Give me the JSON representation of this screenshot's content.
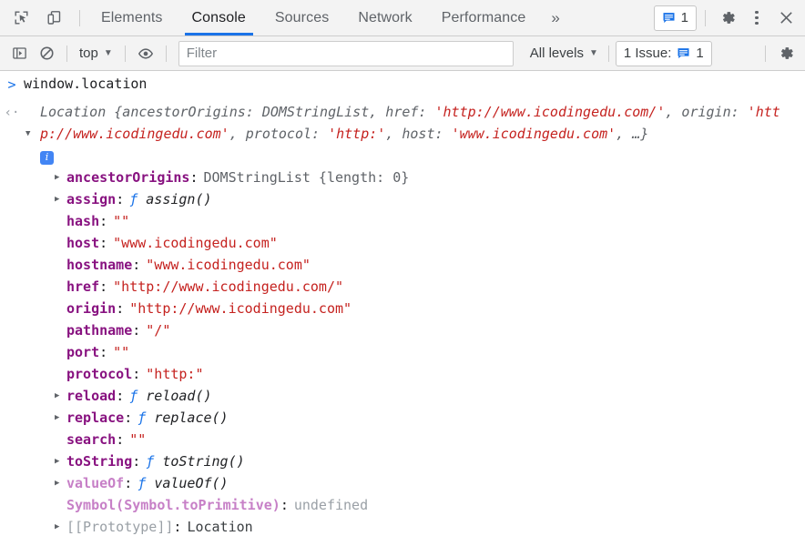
{
  "tabbar": {
    "inspect_icon": "inspect-cursor-icon",
    "device_icon": "device-toolbar-icon",
    "tabs": [
      {
        "label": "Elements",
        "active": false
      },
      {
        "label": "Console",
        "active": true
      },
      {
        "label": "Sources",
        "active": false
      },
      {
        "label": "Network",
        "active": false
      },
      {
        "label": "Performance",
        "active": false
      }
    ],
    "more_tabs_label": "»",
    "issues_count": "1",
    "issues_icon": "message-bubble-icon",
    "settings_icon": "gear-icon",
    "more_options_icon": "kebab-menu-icon",
    "close_icon": "close-icon"
  },
  "filterbar": {
    "sidebar_toggle_icon": "console-sidebar-icon",
    "clear_console_icon": "clear-console-icon",
    "context_label": "top",
    "context_caret": "▼",
    "eye_icon": "live-expression-eye-icon",
    "filter_placeholder": "Filter",
    "filter_value": "",
    "levels_label": "All levels",
    "levels_caret": "▼",
    "issue_button_prefix": "1 Issue:",
    "issue_button_icon": "message-bubble-icon",
    "issue_button_count": "1",
    "settings_icon": "gear-icon"
  },
  "console": {
    "prompt_glyph": ">",
    "result_glyph": "‹·",
    "command": "window.location",
    "result_preview": {
      "collapse_glyph": "▼",
      "class_name": "Location ",
      "segments": [
        {
          "text": "{ancestorOrigins: DOMStringList, href: ",
          "type": "key"
        },
        {
          "text": "'http://www.icodingedu.com/'",
          "type": "string"
        },
        {
          "text": ", origin: ",
          "type": "key"
        },
        {
          "text": "'http://www.icodingedu.com'",
          "type": "string"
        },
        {
          "text": ", protocol: ",
          "type": "key"
        },
        {
          "text": "'http:'",
          "type": "string"
        },
        {
          "text": ", host: ",
          "type": "key"
        },
        {
          "text": "'www.icodingedu.com'",
          "type": "string"
        },
        {
          "text": ", …}",
          "type": "key"
        }
      ]
    },
    "info_badge": "i",
    "properties": [
      {
        "expandable": true,
        "name": "ancestorOrigins",
        "kind": "own",
        "value": "DOMStringList {length: 0}",
        "value_type": "obj"
      },
      {
        "expandable": true,
        "name": "assign",
        "kind": "own",
        "value": "assign()",
        "value_type": "fn"
      },
      {
        "expandable": false,
        "name": "hash",
        "kind": "own",
        "value": "\"\"",
        "value_type": "str"
      },
      {
        "expandable": false,
        "name": "host",
        "kind": "own",
        "value": "\"www.icodingedu.com\"",
        "value_type": "str"
      },
      {
        "expandable": false,
        "name": "hostname",
        "kind": "own",
        "value": "\"www.icodingedu.com\"",
        "value_type": "str"
      },
      {
        "expandable": false,
        "name": "href",
        "kind": "own",
        "value": "\"http://www.icodingedu.com/\"",
        "value_type": "str"
      },
      {
        "expandable": false,
        "name": "origin",
        "kind": "own",
        "value": "\"http://www.icodingedu.com\"",
        "value_type": "str"
      },
      {
        "expandable": false,
        "name": "pathname",
        "kind": "own",
        "value": "\"/\"",
        "value_type": "str"
      },
      {
        "expandable": false,
        "name": "port",
        "kind": "own",
        "value": "\"\"",
        "value_type": "str"
      },
      {
        "expandable": false,
        "name": "protocol",
        "kind": "own",
        "value": "\"http:\"",
        "value_type": "str"
      },
      {
        "expandable": true,
        "name": "reload",
        "kind": "own",
        "value": "reload()",
        "value_type": "fn"
      },
      {
        "expandable": true,
        "name": "replace",
        "kind": "own",
        "value": "replace()",
        "value_type": "fn"
      },
      {
        "expandable": false,
        "name": "search",
        "kind": "own",
        "value": "\"\"",
        "value_type": "str"
      },
      {
        "expandable": true,
        "name": "toString",
        "kind": "own",
        "value": "toString()",
        "value_type": "fn"
      },
      {
        "expandable": true,
        "name": "valueOf",
        "kind": "inherited",
        "value": "valueOf()",
        "value_type": "fn"
      },
      {
        "expandable": false,
        "name": "Symbol(Symbol.toPrimitive)",
        "kind": "inherited",
        "value": "undefined",
        "value_type": "undef"
      },
      {
        "expandable": true,
        "name": "[[Prototype]]",
        "kind": "internal",
        "value": "Location",
        "value_type": "plain"
      }
    ]
  },
  "colors": {
    "accent": "#1a73e8",
    "property_name": "#881280",
    "string_value": "#c5221f",
    "muted": "#5f6368",
    "toolbar_bg": "#f3f3f3"
  }
}
